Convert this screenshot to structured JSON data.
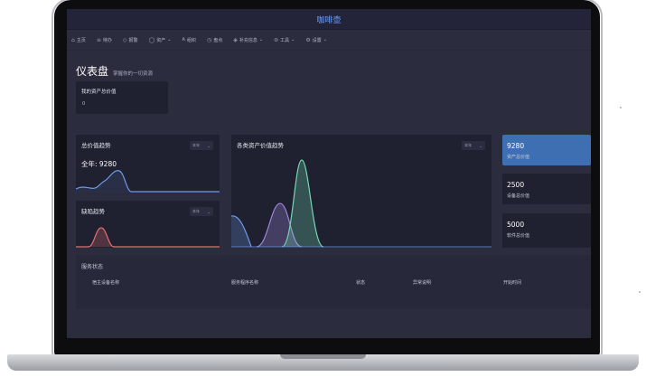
{
  "app": {
    "title": "咖啡壶"
  },
  "nav": [
    {
      "icon": "home-icon",
      "glyph": "⌂",
      "label": "主页",
      "caret": ""
    },
    {
      "icon": "list-icon",
      "glyph": "≡",
      "label": "待办",
      "caret": ""
    },
    {
      "icon": "shield-icon",
      "glyph": "◇",
      "label": "报警",
      "caret": ""
    },
    {
      "icon": "box-icon",
      "glyph": "◯",
      "label": "资产",
      "caret": "⌄"
    },
    {
      "icon": "users-icon",
      "glyph": "ጸ",
      "label": "组织",
      "caret": ""
    },
    {
      "icon": "clock-icon",
      "glyph": "◷",
      "label": "盘点",
      "caret": ""
    },
    {
      "icon": "tag-icon",
      "glyph": "◈",
      "label": "补充信息",
      "caret": "⌄"
    },
    {
      "icon": "layers-icon",
      "glyph": "⊜",
      "label": "工具",
      "caret": "⌄"
    },
    {
      "icon": "gear-icon",
      "glyph": "⚙",
      "label": "设置",
      "caret": "⌄"
    }
  ],
  "page": {
    "title": "仪表盘",
    "subtitle": "掌握你的一切资源"
  },
  "asset_total": {
    "title": "我的资产总价值",
    "value": "0"
  },
  "trend_total": {
    "title": "总价值趋势",
    "select": "本年",
    "year_total": "全年: 9280"
  },
  "trend_defect": {
    "title": "缺陷趋势",
    "select": "本年"
  },
  "trend_category": {
    "title": "各类资产价值趋势",
    "select": "本年"
  },
  "summary": [
    {
      "value": "9280",
      "label": "资产总价值"
    },
    {
      "value": "2500",
      "label": "设备总价值"
    },
    {
      "value": "5000",
      "label": "软件总价值"
    }
  ],
  "service": {
    "title": "服务状态",
    "headers": [
      "宿主设备名称",
      "服务程序名称",
      "状态",
      "异常说明",
      "开始时间"
    ]
  },
  "colors": {
    "accent": "#3f6fb3",
    "line_blue": "#6f9be8",
    "line_red": "#e46f6f",
    "line_purple": "#9d86d6",
    "line_green": "#74d6b2"
  }
}
